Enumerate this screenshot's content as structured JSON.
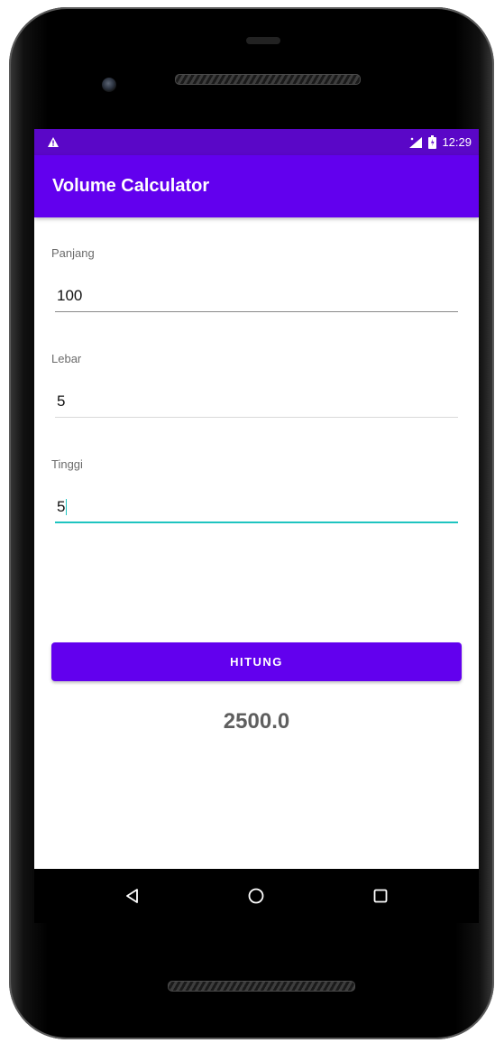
{
  "status_bar": {
    "time": "12:29",
    "alert_icon": "warning-icon",
    "signal_icon": "signal-icon",
    "battery_icon": "battery-icon",
    "color": "#5a07c7"
  },
  "app_bar": {
    "title": "Volume Calculator",
    "color": "#6200ee"
  },
  "form": {
    "fields": [
      {
        "label": "Panjang",
        "value": "100"
      },
      {
        "label": "Lebar",
        "value": "5"
      },
      {
        "label": "Tinggi",
        "value": "5",
        "focused": true
      }
    ],
    "button_label": "HITUNG"
  },
  "result": "2500.0",
  "navigation": {
    "back": "back-triangle-icon",
    "home": "home-circle-icon",
    "recents": "recents-square-icon"
  },
  "accent_color": "#1ec4c0"
}
